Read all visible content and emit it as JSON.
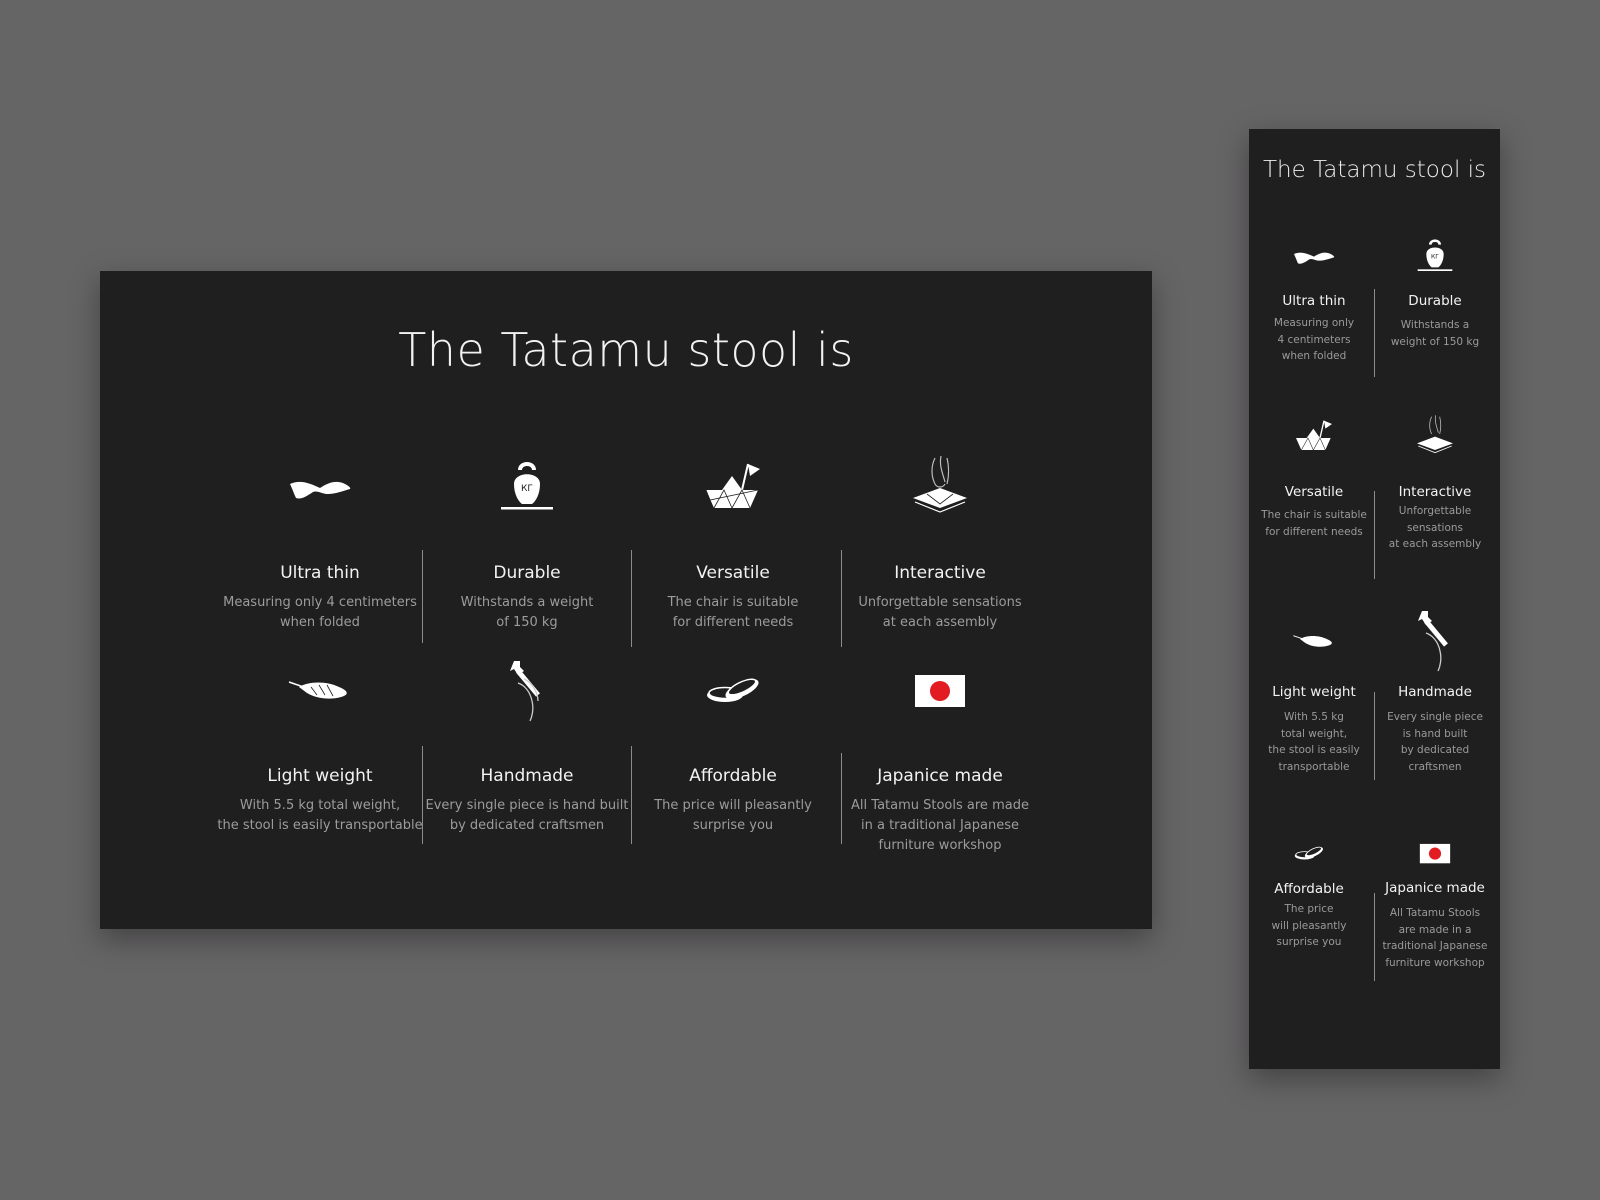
{
  "wide": {
    "title": "The Tatamu stool is",
    "features": [
      {
        "title": "Ultra thin",
        "line1": "Measuring  only 4 centimeters",
        "line2": "when folded",
        "icon": "folded-sheet-icon"
      },
      {
        "title": "Durable",
        "line1": "Withstands a weight",
        "line2": "of 150 kg",
        "icon": "kettlebell-icon"
      },
      {
        "title": "Versatile",
        "line1": "The chair is suitable",
        "line2": "for different needs",
        "icon": "origami-boat-icon"
      },
      {
        "title": "Interactive",
        "line1": "Unforgettable sensations",
        "line2": "at each assembly",
        "icon": "hand-assembly-icon"
      },
      {
        "title": "Light weight",
        "line1": "With 5.5 kg total weight,",
        "line2": "the stool is easily transportable",
        "icon": "feather-icon"
      },
      {
        "title": "Handmade",
        "line1": "Every single piece is hand built",
        "line2": "by dedicated craftsmen",
        "icon": "hand-wrench-icon"
      },
      {
        "title": "Affordable",
        "line1": "The price will pleasantly",
        "line2": "surprise you",
        "icon": "coins-icon"
      },
      {
        "title": "Japanice made",
        "line1": "All Tatamu Stools are made",
        "line2": "in a traditional Japanese",
        "line3": "furniture workshop",
        "icon": "japan-flag-icon"
      }
    ]
  },
  "narrow": {
    "title": "The Tatamu stool is",
    "features": [
      {
        "title": "Ultra thin",
        "lines": [
          "Measuring  only",
          "4 centimeters",
          "when folded"
        ]
      },
      {
        "title": "Durable",
        "lines": [
          "Withstands a",
          "weight of 150 kg"
        ]
      },
      {
        "title": "Versatile",
        "lines": [
          "The chair is suitable",
          "for different needs"
        ]
      },
      {
        "title": "Interactive",
        "lines": [
          "Unforgettable",
          "sensations",
          "at each assembly"
        ]
      },
      {
        "title": "Light weight",
        "lines": [
          "With 5.5 kg",
          "total weight,",
          "the stool is easily",
          "transportable"
        ]
      },
      {
        "title": "Handmade",
        "lines": [
          "Every single piece",
          "is hand built",
          "by dedicated",
          "craftsmen"
        ]
      },
      {
        "title": "Affordable",
        "lines": [
          "The price",
          "will pleasantly",
          "surprise you"
        ]
      },
      {
        "title": "Japanice made",
        "lines": [
          "All Tatamu Stools",
          "are made in a",
          "traditional Japanese",
          "furniture workshop"
        ]
      }
    ]
  },
  "icon_label": "КГ",
  "colors": {
    "background": "#666566",
    "panel": "#1f1f1f",
    "text": "#f3f3f3",
    "muted": "#9c9c9c",
    "flag_red": "#e31b23"
  }
}
